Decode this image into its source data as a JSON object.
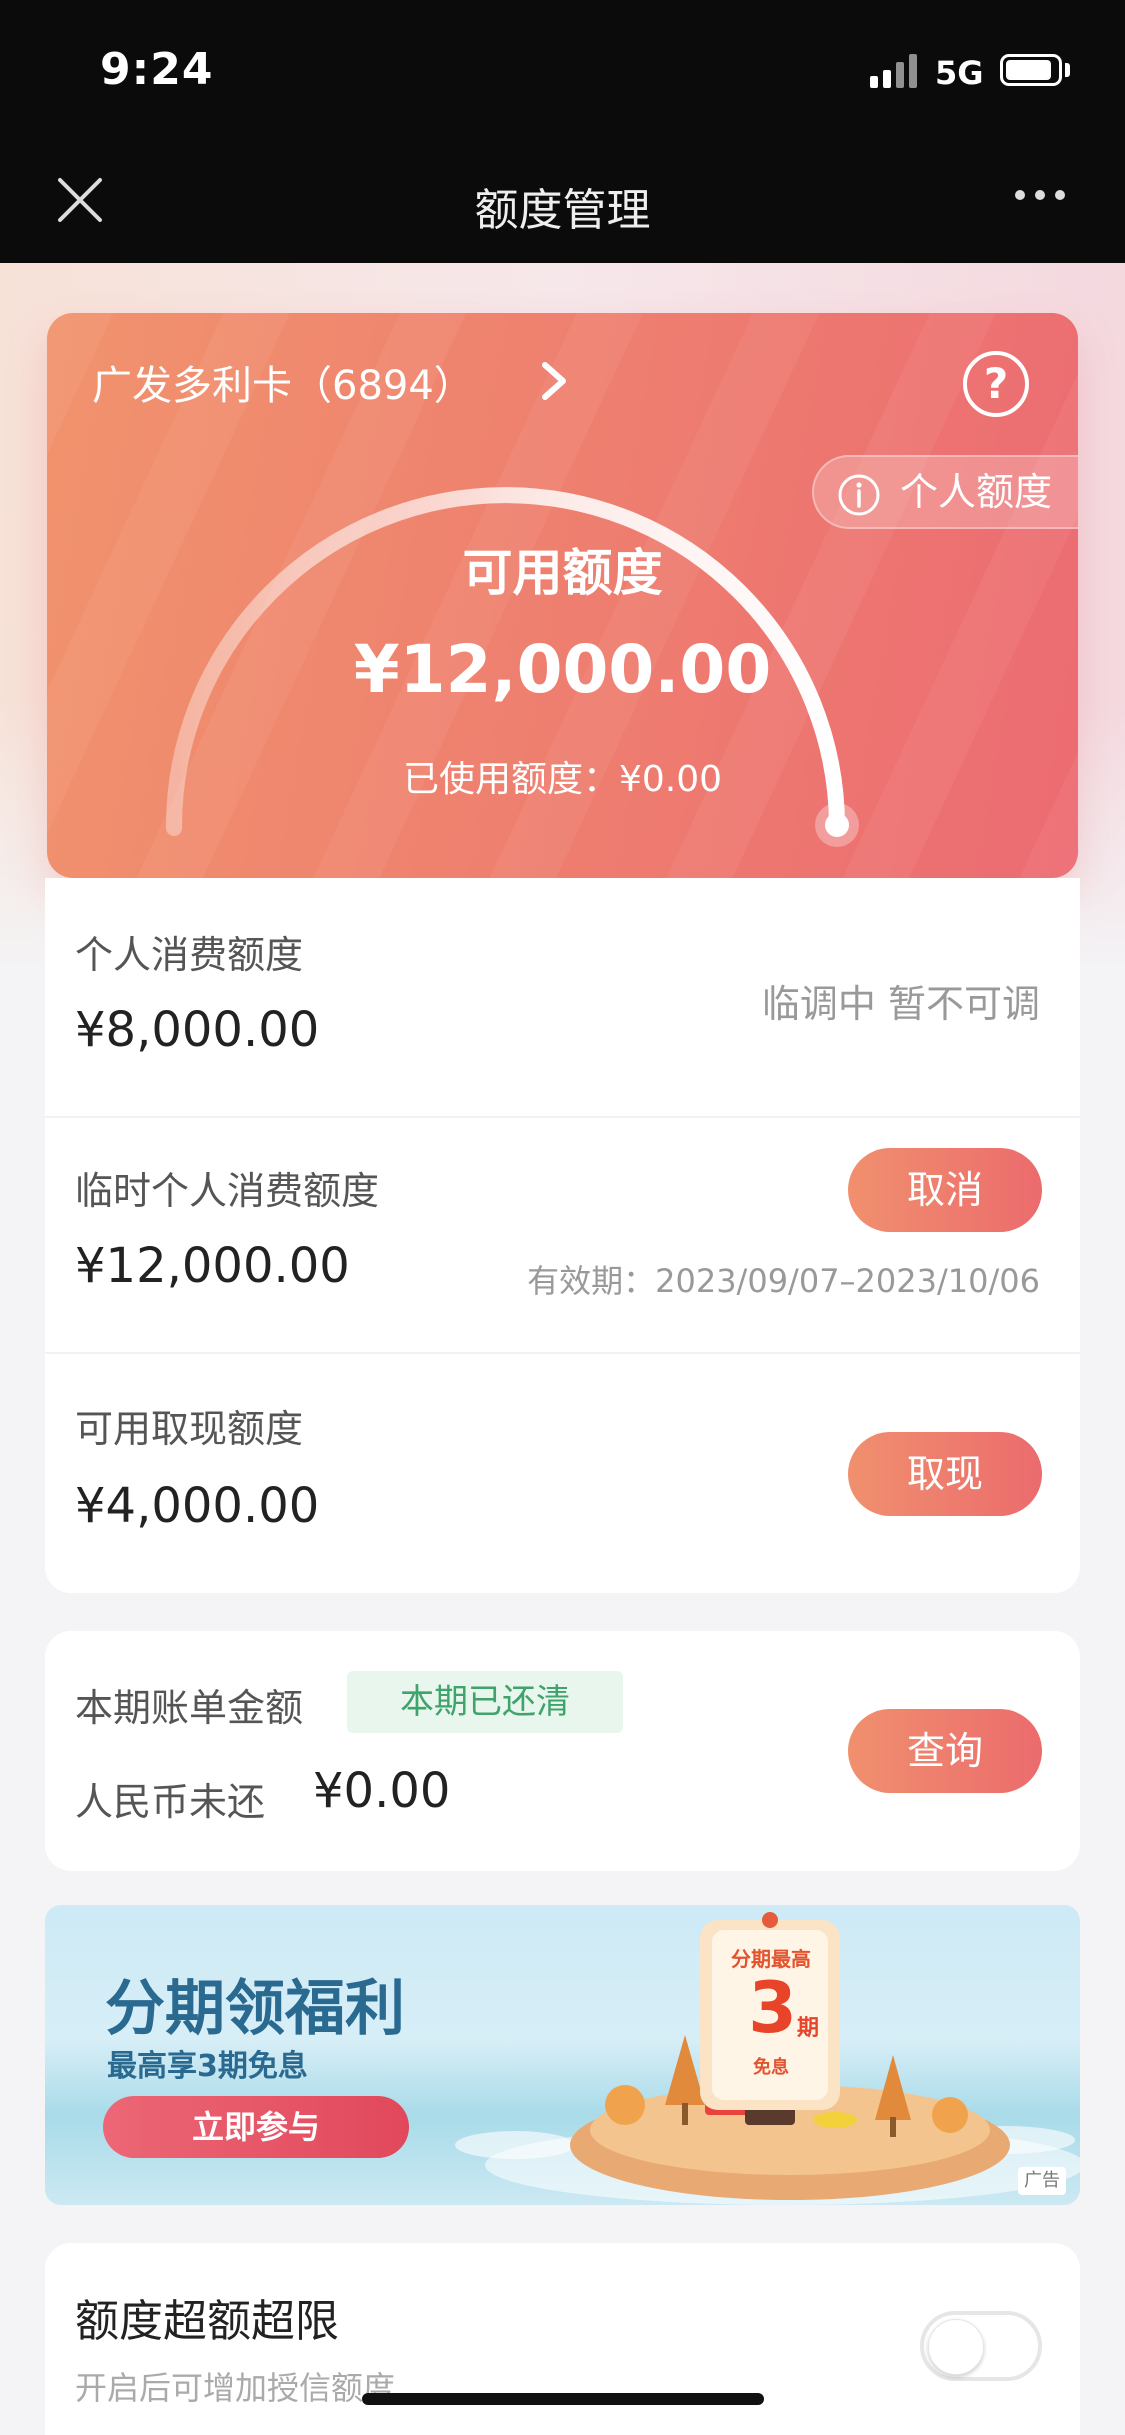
{
  "status_bar": {
    "time": "9:24",
    "network": "5G"
  },
  "nav": {
    "title": "额度管理"
  },
  "card": {
    "name": "广发多利卡（6894）",
    "personal_tag": "个人额度",
    "available_label": "可用额度",
    "available_amount": "¥12,000.00",
    "used_line": "已使用额度：¥0.00",
    "used_fraction": 0.0
  },
  "limits": {
    "personal": {
      "label": "个人消费额度",
      "amount": "¥8,000.00",
      "status": "临调中 暂不可调"
    },
    "temporary": {
      "label": "临时个人消费额度",
      "amount": "¥12,000.00",
      "button": "取消",
      "validity": "有效期：2023/09/07–2023/10/06"
    },
    "cash": {
      "label": "可用取现额度",
      "amount": "¥4,000.00",
      "button": "取现"
    }
  },
  "bill": {
    "label": "本期账单金额",
    "tag": "本期已还清",
    "currency_label": "人民币未还",
    "amount": "¥0.00",
    "button": "查询"
  },
  "banner": {
    "title": "分期领福利",
    "subtitle": "最高享3期免息",
    "button": "立即参与",
    "badge_top": "分期最高",
    "badge_number": "3",
    "badge_unit": "期",
    "badge_bottom": "免息",
    "ad_label": "广告"
  },
  "over_limit": {
    "title": "额度超额超限",
    "subtitle": "开启后可增加授信额度",
    "enabled": false
  }
}
